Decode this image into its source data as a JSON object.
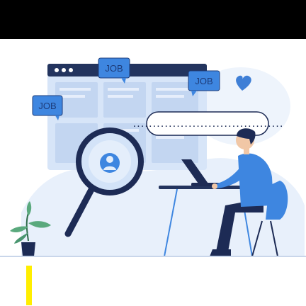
{
  "badges": [
    {
      "label": "JOB"
    },
    {
      "label": "JOB"
    },
    {
      "label": "JOB"
    }
  ],
  "search": {
    "value": "......................................"
  },
  "colors": {
    "top_bar": "#000000",
    "accent": "#3f7fd6",
    "badge": "#3e86e0",
    "dark": "#1d2b55",
    "highlight": "#ffee00"
  },
  "icons": [
    "window-dots-icon",
    "magnifier-icon",
    "user-icon",
    "heart-icon",
    "laptop-icon",
    "plant-icon",
    "chair-icon"
  ]
}
